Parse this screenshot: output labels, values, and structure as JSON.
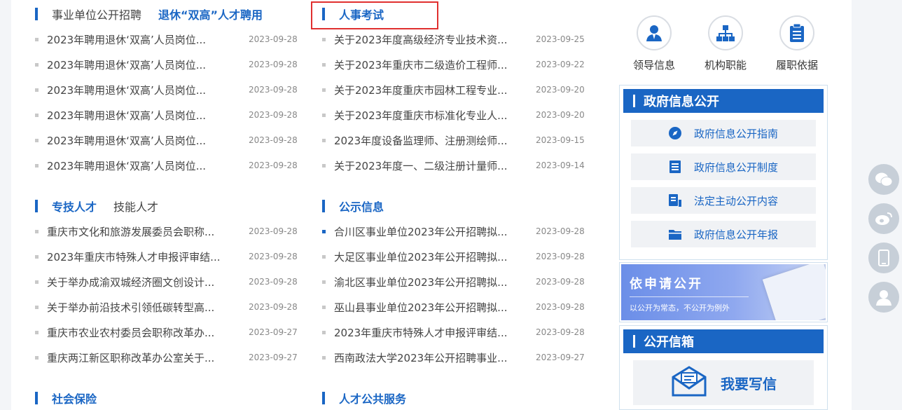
{
  "sections": [
    {
      "tabs": [
        {
          "label": "事业单位公开招聘",
          "active": false
        },
        {
          "label": "退休“双高”人才聘用",
          "active": true
        }
      ],
      "items": [
        {
          "title": "2023年聘用退休‘双高’人员岗位...",
          "date": "2023-09-28"
        },
        {
          "title": "2023年聘用退休‘双高’人员岗位...",
          "date": "2023-09-28"
        },
        {
          "title": "2023年聘用退休‘双高’人员岗位...",
          "date": "2023-09-28"
        },
        {
          "title": "2023年聘用退休‘双高’人员岗位...",
          "date": "2023-09-28"
        },
        {
          "title": "2023年聘用退休‘双高’人员岗位...",
          "date": "2023-09-28"
        },
        {
          "title": "2023年聘用退休‘双高’人员岗位...",
          "date": "2023-09-28"
        }
      ]
    },
    {
      "tabs": [
        {
          "label": "人事考试",
          "active": true
        }
      ],
      "items": [
        {
          "title": "关于2023年度高级经济专业技术资...",
          "date": "2023-09-25"
        },
        {
          "title": "关于2023年重庆市二级造价工程师...",
          "date": "2023-09-22"
        },
        {
          "title": "关于2023年度重庆市园林工程专业...",
          "date": "2023-09-20"
        },
        {
          "title": "关于2023年度重庆市标准化专业人...",
          "date": "2023-09-20"
        },
        {
          "title": "2023年度设备监理师、注册测绘师...",
          "date": "2023-09-15"
        },
        {
          "title": "关于2023年度一、二级注册计量师...",
          "date": "2023-09-14"
        }
      ]
    },
    {
      "tabs": [
        {
          "label": "专技人才",
          "active": true
        },
        {
          "label": "技能人才",
          "active": false
        }
      ],
      "items": [
        {
          "title": "重庆市文化和旅游发展委员会职称...",
          "date": "2023-09-28"
        },
        {
          "title": "2023年重庆市特殊人才申报评审结...",
          "date": "2023-09-28"
        },
        {
          "title": "关于举办成渝双城经济圈文创设计...",
          "date": "2023-09-28"
        },
        {
          "title": "关于举办前沿技术引领低碳转型高...",
          "date": "2023-09-28"
        },
        {
          "title": "重庆市农业农村委员会职称改革办...",
          "date": "2023-09-27"
        },
        {
          "title": "重庆两江新区职称改革办公室关于...",
          "date": "2023-09-27"
        }
      ]
    },
    {
      "tabs": [
        {
          "label": "公示信息",
          "active": true
        }
      ],
      "items": [
        {
          "title": "合川区事业单位2023年公开招聘拟...",
          "date": "2023-09-28"
        },
        {
          "title": "大足区事业单位2023年公开招聘拟...",
          "date": "2023-09-28"
        },
        {
          "title": "渝北区事业单位2023年公开招聘拟...",
          "date": "2023-09-28"
        },
        {
          "title": "巫山县事业单位2023年公开招聘拟...",
          "date": "2023-09-28"
        },
        {
          "title": "2023年重庆市特殊人才申报评审结...",
          "date": "2023-09-28"
        },
        {
          "title": "西南政法大学2023年公开招聘事业...",
          "date": "2023-09-27"
        }
      ]
    },
    {
      "tabs": [
        {
          "label": "社会保险",
          "active": true
        }
      ],
      "items": []
    },
    {
      "tabs": [
        {
          "label": "人才公共服务",
          "active": true
        }
      ],
      "items": []
    }
  ],
  "quick_icons": [
    {
      "label": "领导信息",
      "icon": "person-icon"
    },
    {
      "label": "机构职能",
      "icon": "org-chart-icon"
    },
    {
      "label": "履职依据",
      "icon": "clipboard-icon"
    }
  ],
  "gov_info": {
    "title": "政府信息公开",
    "items": [
      {
        "label": "政府信息公开指南",
        "icon": "compass-icon"
      },
      {
        "label": "政府信息公开制度",
        "icon": "document-list-icon"
      },
      {
        "label": "法定主动公开内容",
        "icon": "file-edit-icon"
      },
      {
        "label": "政府信息公开年报",
        "icon": "folder-icon"
      }
    ]
  },
  "apply_banner": {
    "title": "依申请公开",
    "subtitle": "以公开为常态，不公开为例外"
  },
  "mailbox": {
    "title": "公开信箱",
    "button_label": "我要写信"
  },
  "floating": [
    "wechat-icon",
    "weibo-icon",
    "mobile-icon",
    "user-service-icon"
  ],
  "colors": {
    "accent": "#1a66c4",
    "highlight_border": "#e0302f",
    "banner_gradient_start": "#6b8ee8"
  }
}
